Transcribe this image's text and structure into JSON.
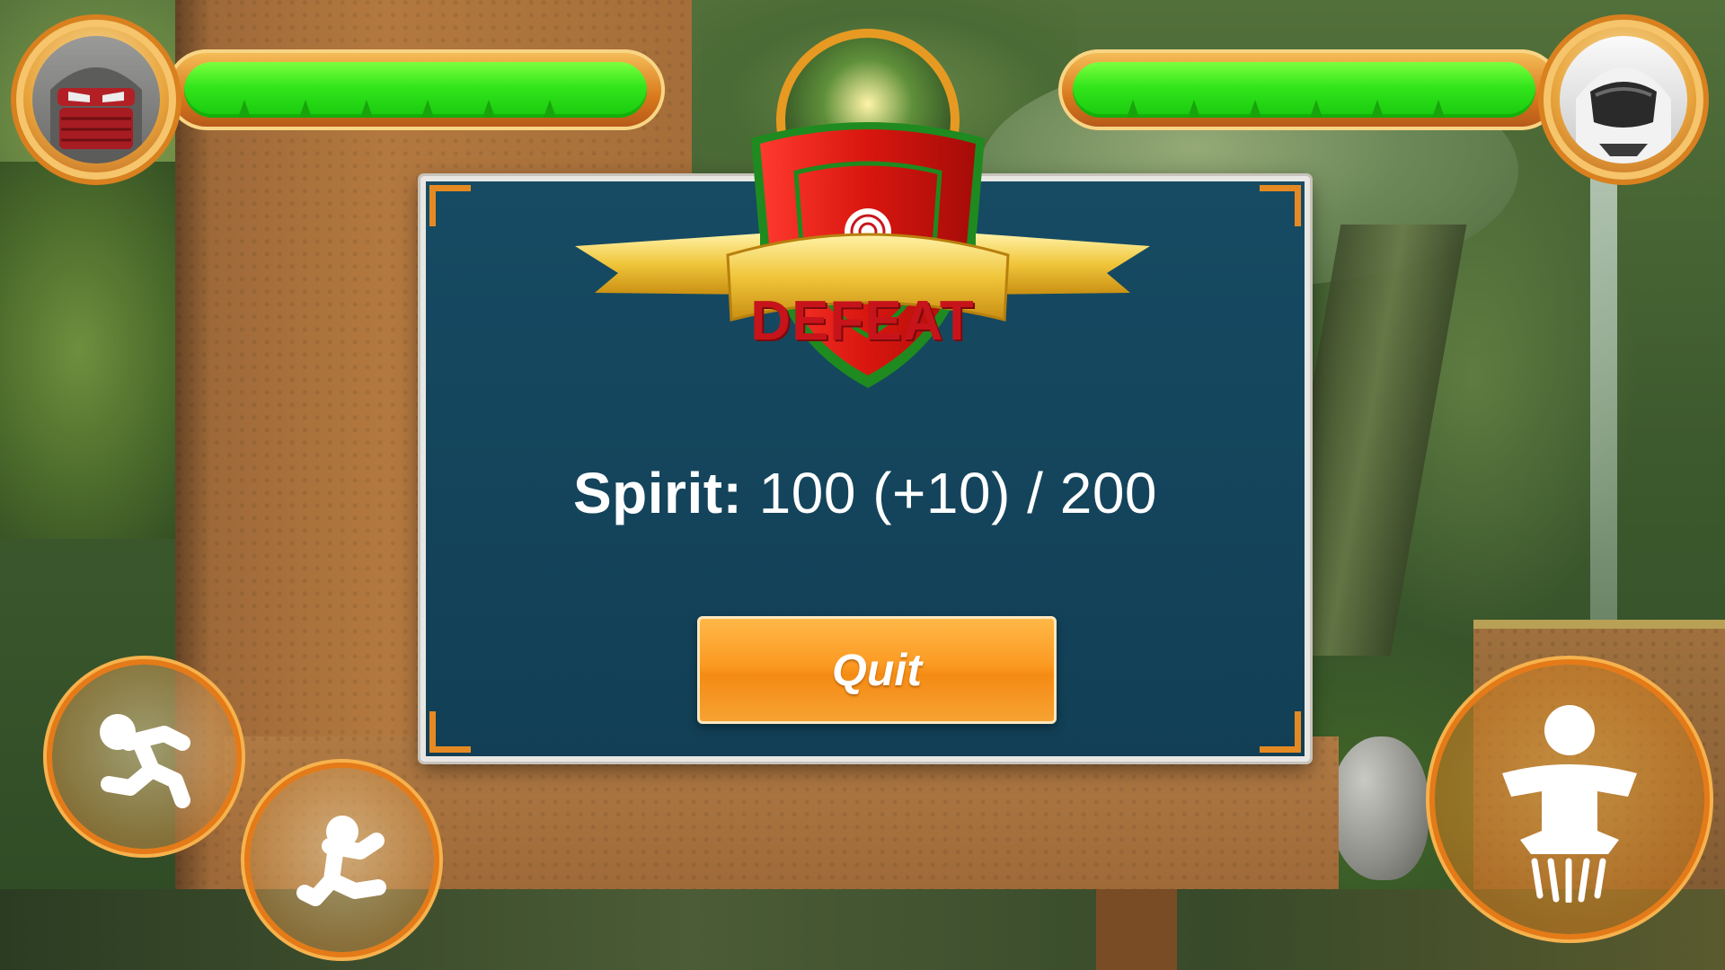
{
  "hud": {
    "player": {
      "name": "player",
      "health_fraction": 1.0,
      "avatar_icon": "red-ninja-icon"
    },
    "enemy": {
      "name": "enemy",
      "health_fraction": 1.0,
      "avatar_icon": "white-ninja-icon"
    },
    "health_color": "#32e51b",
    "frame_color": "#e47a18"
  },
  "controls": {
    "run_icon": "running-figure-icon",
    "roll_icon": "rolling-figure-icon",
    "jump_icon": "jumping-figure-icon"
  },
  "result_dialog": {
    "banner_text": "DEFEAT",
    "emblem_icon": "rose-shield-icon",
    "spirit_label": "Spirit:",
    "spirit_value": "100 (+10) / 200",
    "quit_label": "Quit",
    "panel_color": "#164b63",
    "button_color": "#f48b14",
    "banner_text_color": "#c6141a"
  }
}
